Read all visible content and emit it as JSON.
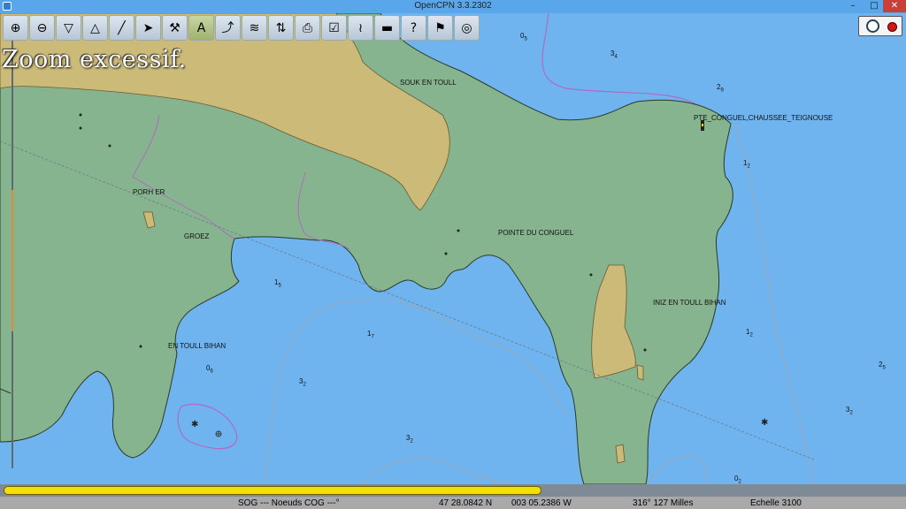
{
  "window": {
    "title": "OpenCPN 3.3.2302",
    "minimize_glyph": "–",
    "maximize_glyph": "□",
    "close_glyph": "✕"
  },
  "toolbar": {
    "tools": [
      {
        "name": "zoom-in-icon",
        "glyph": "⊕"
      },
      {
        "name": "zoom-out-icon",
        "glyph": "⊖"
      },
      {
        "name": "scale-in-icon",
        "glyph": "▽"
      },
      {
        "name": "scale-out-icon",
        "glyph": "△"
      },
      {
        "name": "route-icon",
        "glyph": "╱"
      },
      {
        "name": "auto-follow-icon",
        "glyph": "➤"
      },
      {
        "name": "options-icon",
        "glyph": "⚒"
      },
      {
        "name": "text-icon",
        "glyph": "A"
      },
      {
        "name": "current-icon",
        "glyph": "⤴"
      },
      {
        "name": "tide-icon",
        "glyph": "≋"
      },
      {
        "name": "full-screen-icon",
        "glyph": "⇅"
      },
      {
        "name": "print-icon",
        "glyph": "⎙"
      },
      {
        "name": "route-manager-icon",
        "glyph": "☑"
      },
      {
        "name": "track-icon",
        "glyph": "≀"
      },
      {
        "name": "color-scheme-icon",
        "glyph": "▬"
      },
      {
        "name": "help-icon",
        "glyph": "?"
      },
      {
        "name": "mob-icon",
        "glyph": "⚑"
      },
      {
        "name": "lifebuoy-icon",
        "glyph": "◎"
      }
    ]
  },
  "chart": {
    "zoom_message": "Zoom excessif.",
    "places": [
      {
        "name": "place-souk-en-toull",
        "text": "SOUK EN TOULL"
      },
      {
        "name": "place-pte-conguel",
        "text": "PTE_CONGUEL,CHAUSSEE_TEIGNOUSE"
      },
      {
        "name": "place-porh-er",
        "text": "PORH ER"
      },
      {
        "name": "place-groez",
        "text": "GROEZ"
      },
      {
        "name": "place-pointe-du-conguel",
        "text": "POINTE DU CONGUEL"
      },
      {
        "name": "place-iniz-en-toull-bihan",
        "text": "INIZ EN TOULL BIHAN"
      },
      {
        "name": "place-en-toull-bihan",
        "text": "EN TOULL BIHAN"
      }
    ],
    "soundings": [
      {
        "m": "0",
        "d": "5"
      },
      {
        "m": "3",
        "d": "4"
      },
      {
        "m": "2",
        "d": "9"
      },
      {
        "m": "1",
        "d": "2"
      },
      {
        "m": "1",
        "d": "5"
      },
      {
        "m": "1",
        "d": "7"
      },
      {
        "m": "1",
        "d": "2"
      },
      {
        "m": "2",
        "d": "5"
      },
      {
        "m": "0",
        "d": "6"
      },
      {
        "m": "3",
        "d": "2"
      },
      {
        "m": "3",
        "d": "2"
      },
      {
        "m": "3",
        "d": "2"
      },
      {
        "m": "0",
        "d": "2"
      }
    ]
  },
  "status": {
    "sog_cog": "SOG --- Noeuds COG ---°",
    "latitude": "47 28.0842 N",
    "longitude": "003 05.2386 W",
    "bearing_range": "316°  127 Milles",
    "scale": "Echelle 3100"
  },
  "colors": {
    "sea": "#6fb4ee",
    "land": "#86b48f",
    "sand": "#ccba78",
    "piano_key": "#f4e000"
  }
}
